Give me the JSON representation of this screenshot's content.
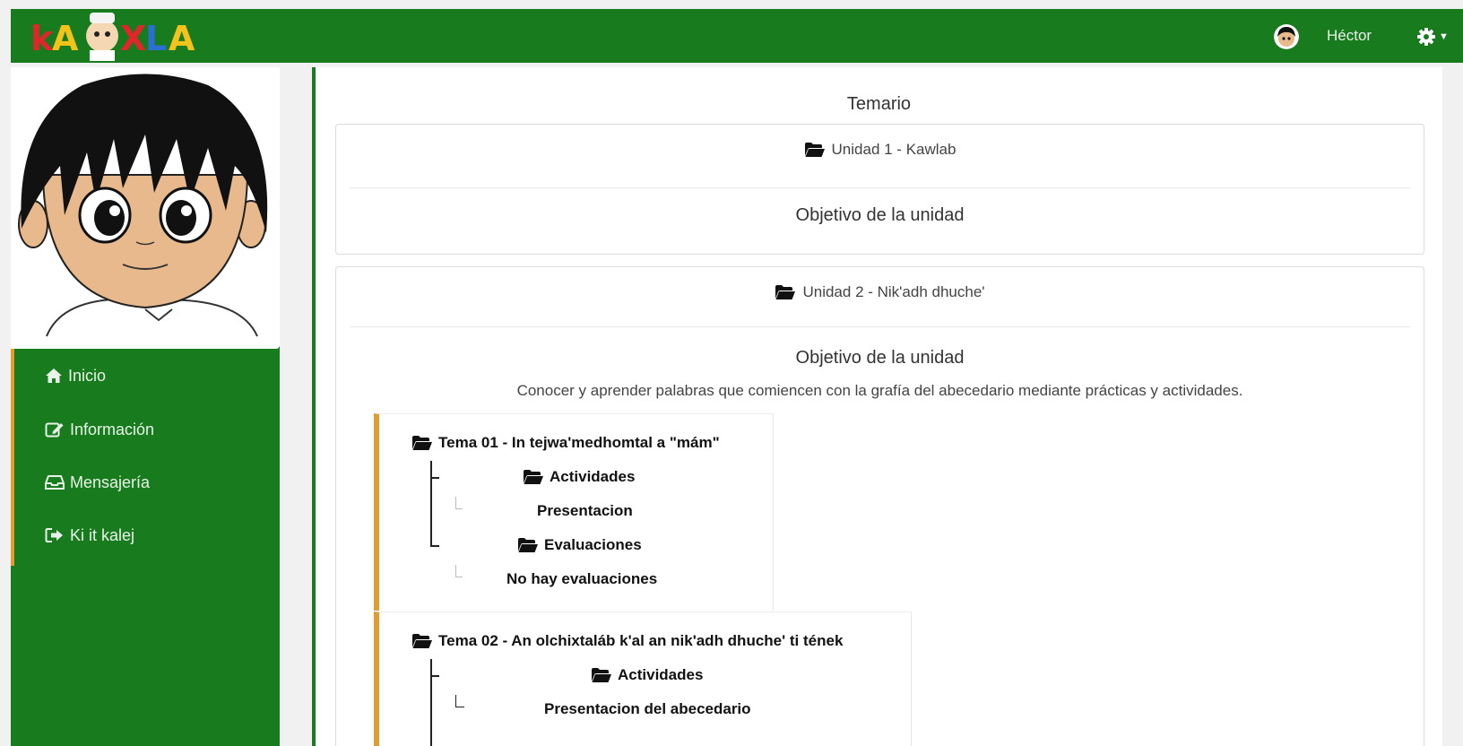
{
  "navbar": {
    "brand": "kAWXLA",
    "user_name": "Héctor",
    "settings_icon": "gear-icon"
  },
  "sidebar": {
    "items": [
      {
        "label": "Inicio",
        "icon": "home-icon"
      },
      {
        "label": "Información",
        "icon": "edit-icon"
      },
      {
        "label": "Mensajería",
        "icon": "inbox-icon"
      },
      {
        "label": "Ki it kalej",
        "icon": "sign-out-icon"
      }
    ]
  },
  "main": {
    "title": "Temario",
    "units": [
      {
        "name": "Unidad 1 - Kawlab",
        "objective_label": "Objetivo de la unidad"
      },
      {
        "name": "Unidad 2 - Nik'adh dhuche'",
        "objective_label": "Objetivo de la unidad",
        "objective_text": "Conocer y aprender palabras que comiencen con la grafía del abecedario mediante prácticas y actividades.",
        "temas": [
          {
            "title": "Tema 01 - In tejwa'medhomtal a \"mám\"",
            "activities_label": "Actividades",
            "activity": "Presentacion",
            "evaluations_label": "Evaluaciones",
            "evaluation": "No hay evaluaciones"
          },
          {
            "title": "Tema 02 - An olchixtaláb k'al an nik'adh dhuche' ti tének",
            "activities_label": "Actividades",
            "activity": "Presentacion del abecedario"
          }
        ]
      }
    ]
  },
  "colors": {
    "primary_green": "#187c1f",
    "accent_orange": "#e69b2f"
  }
}
